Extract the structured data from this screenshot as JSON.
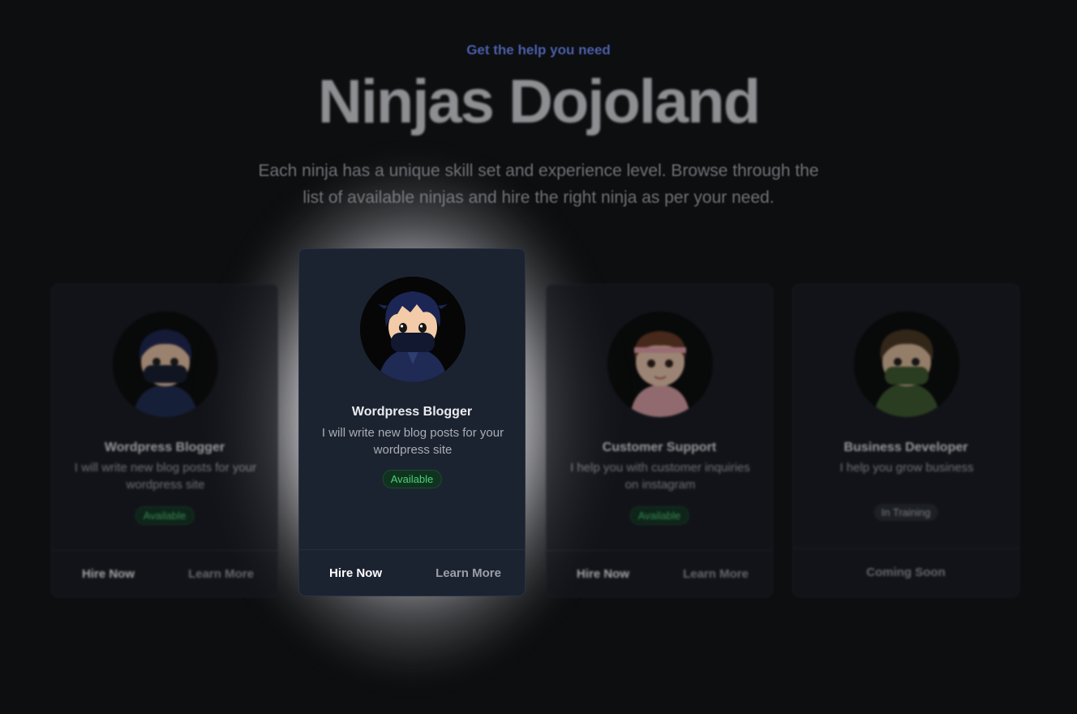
{
  "hero": {
    "eyebrow": "Get the help you need",
    "title": "Ninjas Dojoland",
    "subtitle": "Each ninja has a unique skill set and experience level. Browse through the list of available ninjas and hire the right ninja as per your need."
  },
  "cards": [
    {
      "name": "Wordpress Blogger",
      "description": "I will write new blog posts for your wordpress site",
      "status": "Available",
      "hire_label": "Hire Now",
      "learn_label": "Learn More",
      "avatar_icon": "ninja-navy-avatar"
    },
    {
      "name": "Wordpress Blogger",
      "description": "I will write new blog posts for your wordpress site",
      "status": "Available",
      "hire_label": "Hire Now",
      "learn_label": "Learn More",
      "avatar_icon": "ninja-navy-avatar"
    },
    {
      "name": "Customer Support",
      "description": "I help you with customer inquiries on instagram",
      "status": "Available",
      "hire_label": "Hire Now",
      "learn_label": "Learn More",
      "avatar_icon": "ninja-pink-avatar"
    },
    {
      "name": "Business Developer",
      "description": "I help you grow business",
      "status": "In Training",
      "coming_label": "Coming Soon",
      "avatar_icon": "ninja-green-avatar"
    }
  ],
  "colors": {
    "accent": "#4a5fa8",
    "available": "#4cd07a",
    "background": "#0d0e10",
    "card": "#14171d"
  }
}
